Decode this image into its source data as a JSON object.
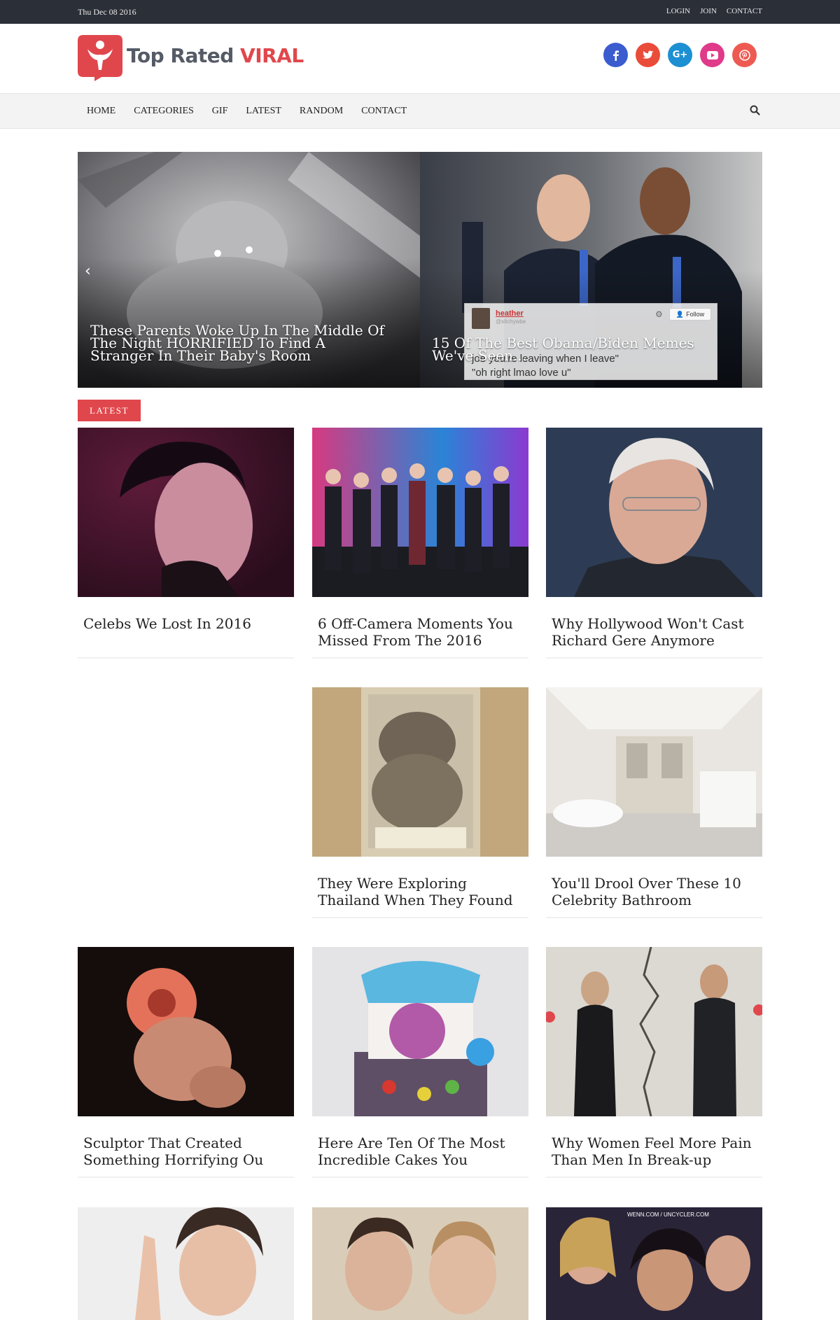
{
  "topbar": {
    "date": "Thu Dec 08 2016",
    "links": [
      "LOGIN",
      "JOIN",
      "CONTACT"
    ]
  },
  "logo": {
    "text_a": "Top Rated",
    "text_b": "VIRAL",
    "brand_color": "#e0474c"
  },
  "social": [
    {
      "icon": "facebook-icon",
      "glyph": "f",
      "color": "#3b5ccf"
    },
    {
      "icon": "twitter-icon",
      "glyph": "t",
      "color": "#ea4c3a"
    },
    {
      "icon": "google-plus-icon",
      "glyph": "G+",
      "color": "#1d8fd3"
    },
    {
      "icon": "youtube-icon",
      "glyph": "▶",
      "color": "#e03a8a"
    },
    {
      "icon": "pinterest-icon",
      "glyph": "p",
      "color": "#ee5a52"
    }
  ],
  "nav": {
    "items": [
      "HOME",
      "CATEGORIES",
      "GIF",
      "LATEST",
      "RANDOM",
      "CONTACT"
    ],
    "search_icon": "search-icon"
  },
  "slider": {
    "slides": [
      {
        "title": "These Parents Woke Up In The Middle Of The Night HORRIFIED To Find A Stranger In Their Baby's Room"
      },
      {
        "title": "15 Of The Best Obama/Biden Memes We've Seen..."
      }
    ],
    "tweet": {
      "name": "heather",
      "handle": "@xitchywbe",
      "follow": "Follow",
      "line1": "joe you're leaving when I leave\"",
      "line2": "\"oh right lmao love u\""
    }
  },
  "latest_label": "LATEST",
  "cards": [
    {
      "title": "Celebs We Lost In 2016"
    },
    {
      "title": "6 Off-Camera Moments You Missed From The 2016"
    },
    {
      "title": "Why Hollywood Won't Cast Richard Gere Anymore"
    },
    {
      "title": "They Were Exploring Thailand When They Found"
    },
    {
      "title": "You'll Drool Over These 10 Celebrity Bathroom"
    },
    {
      "title": "Sculptor That Created Something Horrifying Ou"
    },
    {
      "title": "Here Are Ten Of The Most Incredible Cakes You"
    },
    {
      "title": "Why Women Feel More Pain Than Men In Break-up"
    }
  ],
  "bottom_thumb_caption": "WENN.COM / UNCYCLER.COM"
}
